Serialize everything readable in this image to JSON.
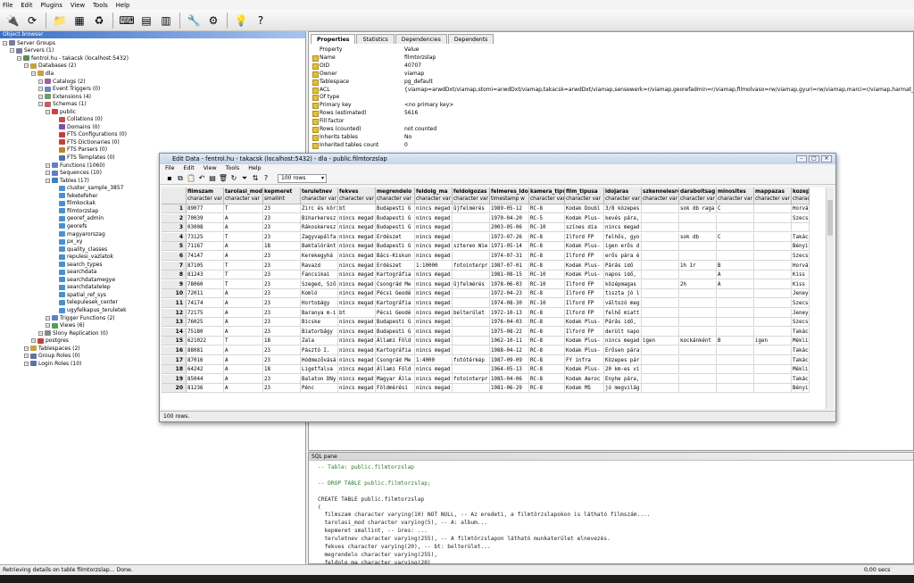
{
  "menubar": [
    "File",
    "Edit",
    "Plugins",
    "View",
    "Tools",
    "Help"
  ],
  "toolbar_icons": [
    "connect-icon",
    "refresh-icon",
    "folder-icon",
    "properties-icon",
    "recycle-icon",
    "sql-icon",
    "table-view-icon",
    "filter-icon",
    "wrench-icon",
    "plugin-icon",
    "help-bulb-icon",
    "help-icon"
  ],
  "browser": {
    "title": "Object browser",
    "tree": [
      {
        "label": "Server Groups",
        "level": 0,
        "icon": "#7a7aa0"
      },
      {
        "label": "Servers (1)",
        "level": 1,
        "icon": "#7a7aa0"
      },
      {
        "label": "fentrol.hu - takacsk (localhost:5432)",
        "level": 2,
        "icon": "#5a8a5a"
      },
      {
        "label": "Databases (2)",
        "level": 3,
        "icon": "#c8a040"
      },
      {
        "label": "dla",
        "level": 4,
        "icon": "#c8a040"
      },
      {
        "label": "Catalogs (2)",
        "level": 5,
        "icon": "#a060a0"
      },
      {
        "label": "Event Triggers (0)",
        "level": 5,
        "icon": "#6a8ac0"
      },
      {
        "label": "Extensions (4)",
        "level": 5,
        "icon": "#6aa06a"
      },
      {
        "label": "Schemas (1)",
        "level": 5,
        "icon": "#c06060"
      },
      {
        "label": "public",
        "level": 6,
        "icon": "#d04040"
      },
      {
        "label": "Collations (0)",
        "level": 7,
        "icon": "#c05050"
      },
      {
        "label": "Domains (0)",
        "level": 7,
        "icon": "#8050a0"
      },
      {
        "label": "FTS Configurations (0)",
        "level": 7,
        "icon": "#c04040"
      },
      {
        "label": "FTS Dictionaries (0)",
        "level": 7,
        "icon": "#c04040"
      },
      {
        "label": "FTS Parsers (0)",
        "level": 7,
        "icon": "#c08030"
      },
      {
        "label": "FTS Templates (0)",
        "level": 7,
        "icon": "#5070b0"
      },
      {
        "label": "Functions (1060)",
        "level": 6,
        "icon": "#6080c0"
      },
      {
        "label": "Sequences (10)",
        "level": 6,
        "icon": "#6080c0"
      },
      {
        "label": "Tables (17)",
        "level": 6,
        "icon": "#4080c0"
      },
      {
        "label": "cluster_sample_3857",
        "level": 7,
        "icon": "#4a90d0"
      },
      {
        "label": "feketefeher",
        "level": 7,
        "icon": "#4a90d0"
      },
      {
        "label": "filmkockak",
        "level": 7,
        "icon": "#4a90d0"
      },
      {
        "label": "filmtorzslap",
        "level": 7,
        "icon": "#4a90d0"
      },
      {
        "label": "georef_admin",
        "level": 7,
        "icon": "#4a90d0"
      },
      {
        "label": "georefs",
        "level": 7,
        "icon": "#4a90d0"
      },
      {
        "label": "magyarorszag",
        "level": 7,
        "icon": "#4a90d0"
      },
      {
        "label": "px_xy",
        "level": 7,
        "icon": "#4a90d0"
      },
      {
        "label": "quality_classes",
        "level": 7,
        "icon": "#4a90d0"
      },
      {
        "label": "repulesi_vazlatok",
        "level": 7,
        "icon": "#4a90d0"
      },
      {
        "label": "search_types",
        "level": 7,
        "icon": "#4a90d0"
      },
      {
        "label": "searchdata",
        "level": 7,
        "icon": "#4a90d0"
      },
      {
        "label": "searchdatamegye",
        "level": 7,
        "icon": "#4a90d0"
      },
      {
        "label": "searchdatatelep",
        "level": 7,
        "icon": "#4a90d0"
      },
      {
        "label": "spatial_ref_sys",
        "level": 7,
        "icon": "#4a90d0"
      },
      {
        "label": "telepulesek_center",
        "level": 7,
        "icon": "#4a90d0"
      },
      {
        "label": "ugyfelkapus_teruletek",
        "level": 7,
        "icon": "#4a90d0"
      },
      {
        "label": "Trigger Functions (2)",
        "level": 6,
        "icon": "#6080c0"
      },
      {
        "label": "Views (6)",
        "level": 6,
        "icon": "#50a050"
      },
      {
        "label": "Slony Replication (0)",
        "level": 5,
        "icon": "#8a8a8a"
      },
      {
        "label": "postgres",
        "level": 4,
        "icon": "#c04040"
      },
      {
        "label": "Tablespaces (2)",
        "level": 3,
        "icon": "#c8a040"
      },
      {
        "label": "Group Roles (0)",
        "level": 3,
        "icon": "#6070a0"
      },
      {
        "label": "Login Roles (10)",
        "level": 3,
        "icon": "#6070a0"
      }
    ]
  },
  "props": {
    "tabs": [
      "Properties",
      "Statistics",
      "Dependencies",
      "Dependents"
    ],
    "head": {
      "k": "Property",
      "v": "Value"
    },
    "rows": [
      {
        "k": "Name",
        "v": "filmtorzslap"
      },
      {
        "k": "OID",
        "v": "40707"
      },
      {
        "k": "Owner",
        "v": "viamap"
      },
      {
        "k": "Tablespace",
        "v": "pg_default"
      },
      {
        "k": "ACL",
        "v": "{viamap=arwdDxt/viamap,stomi=arwdDxt/viamap,takacsk=arwdDxt/viamap,sensewerk=r/viamap,georefadmin=r/viamap,filmolvaso=rw/viamap,gyuri=rw/viamap,marci=r/viamap,harmat_miklos=rw/viamap}"
      },
      {
        "k": "Of type",
        "v": ""
      },
      {
        "k": "Primary key",
        "v": "<no primary key>"
      },
      {
        "k": "Rows (estimated)",
        "v": "5616"
      },
      {
        "k": "Fill factor",
        "v": ""
      },
      {
        "k": "Rows (counted)",
        "v": "not counted"
      },
      {
        "k": "Inherits tables",
        "v": "No"
      },
      {
        "k": "Inherited tables count",
        "v": "0"
      }
    ]
  },
  "sql": {
    "title": "SQL pane",
    "lines": [
      {
        "t": "-- Table: public.filmtorzslap",
        "c": true
      },
      {
        "t": "",
        "c": false
      },
      {
        "t": "-- DROP TABLE public.filmtorzslap;",
        "c": true
      },
      {
        "t": "",
        "c": false
      },
      {
        "t": "CREATE TABLE public.filmtorzslap",
        "c": false
      },
      {
        "t": "(",
        "c": false
      },
      {
        "t": "  filmszam character varying(10) NOT NULL, -- Az eredeti, a filmtörzslapokon is látható filmszám....",
        "c": false
      },
      {
        "t": "  tarolasi_mod character varying(5), -- A: album...",
        "c": false
      },
      {
        "t": "  kepmeret smallint, -- üres: ...",
        "c": false
      },
      {
        "t": "  teruletnev character varying(255), -- A filmtörzslapon látható munkaterület elnevezés.",
        "c": false
      },
      {
        "t": "  fekves character varying(20), -- bt: belterület...",
        "c": false
      },
      {
        "t": "  megrendelo character varying(255),",
        "c": false
      },
      {
        "t": "  feldolg_ma character varying(20)",
        "c": false
      }
    ]
  },
  "status": {
    "left": "Retrieving details on table filmtorzslap... Done.",
    "right": "0,00 secs"
  },
  "edit": {
    "title": "Edit Data - fentrol.hu - takacsk (localhost:5432) - dla - public.filmtorzslap",
    "menu": [
      "File",
      "Edit",
      "View",
      "Tools",
      "Help"
    ],
    "rows_select": "100 rows",
    "status": "100 rows.",
    "columns": [
      {
        "n": "filmszam",
        "t": "character var"
      },
      {
        "n": "tarolasi_mod",
        "t": "character var"
      },
      {
        "n": "kepmeret",
        "t": "smallint"
      },
      {
        "n": "teruletnev",
        "t": "character var"
      },
      {
        "n": "fekves",
        "t": "character var"
      },
      {
        "n": "megrendelo",
        "t": "character var"
      },
      {
        "n": "feldolg_ma",
        "t": "character var"
      },
      {
        "n": "feldolgozas",
        "t": "character var"
      },
      {
        "n": "felmeres_ido",
        "t": "timestamp w"
      },
      {
        "n": "kamera_tipus",
        "t": "character var"
      },
      {
        "n": "film_tipusa",
        "t": "character var"
      },
      {
        "n": "idojaras",
        "t": "character var"
      },
      {
        "n": "szkennelesre",
        "t": "character var"
      },
      {
        "n": "daraboltsag",
        "t": "character var"
      },
      {
        "n": "minosites",
        "t": "character var"
      },
      {
        "n": "mappazas",
        "t": "character var"
      },
      {
        "n": "kozep",
        "t": "charac"
      }
    ],
    "rows": [
      [
        "89077",
        "T",
        "23",
        "Zirc és köri",
        "bt",
        "Budapesti G",
        "nincs megad",
        "ûjfelmérés",
        "1989-05-12",
        "RC-8",
        "Kodak Doubl",
        "3/8 közepes",
        "",
        "sok db raga",
        "C",
        "",
        "Horvá"
      ],
      [
        "70039",
        "A",
        "23",
        "Biharkeresz",
        "nincs megad",
        "Budapesti G",
        "nincs megad",
        "",
        "1970-04-20",
        "RC-5",
        "Kodak Plus-",
        "kevés pára,",
        "",
        "",
        "",
        "",
        "Szecs"
      ],
      [
        "03008",
        "A",
        "23",
        "Rákoskeresz",
        "nincs megad",
        "Budapesti G",
        "nincs megad",
        "",
        "2003-05-06",
        "RC-10",
        "színes dia",
        "nincs megad",
        "",
        "",
        "",
        "",
        ""
      ],
      [
        "73125",
        "T",
        "23",
        "Zagyvapálfa",
        "nincs megad",
        "Erdészet",
        "nincs megad",
        "",
        "1973-07-26",
        "RC-8",
        "Ilford FP",
        "felhős, gyo",
        "",
        "sok db",
        "C",
        "",
        "Takác"
      ],
      [
        "71167",
        "A",
        "18",
        "Baktalóránt",
        "nincs megad",
        "Budapesti G",
        "nincs megad",
        "sztereo Wie",
        "1971-05-14",
        "RC-8",
        "Kodak Plus-",
        "igen erős d",
        "",
        "",
        "",
        "",
        "Bényi"
      ],
      [
        "74147",
        "A",
        "23",
        "Kerekegyhá",
        "nincs megad",
        "Bács-Kiskun",
        "nincs megad",
        "",
        "1974-07-31",
        "RC-8",
        "Ilford FP",
        "erős pára é",
        "",
        "",
        "",
        "",
        "Szecs"
      ],
      [
        "87105",
        "T",
        "23",
        "Ravazd",
        "nincs megad",
        "Erdészet",
        "1:10000",
        "fotointerpr",
        "1987-07-01",
        "RC-8",
        "Kodak Plus-",
        "Párás idő",
        "",
        "1h 1r",
        "B",
        "",
        "Horvá"
      ],
      [
        "81243",
        "T",
        "23",
        "Fancsikai",
        "nincs megad",
        "Kartográfia",
        "nincs megad",
        "",
        "1981-08-15",
        "RC-10",
        "Kodak Plus-",
        "napos idő,",
        "",
        "",
        "A",
        "",
        "Kiss"
      ],
      [
        "78060",
        "T",
        "23",
        "Szeged, Sző",
        "nincs megad",
        "Csongrád Me",
        "nincs megad",
        "ûjfelmérés",
        "1978-06-03",
        "RC-10",
        "Ilford FP",
        "középmagas",
        "",
        "2h",
        "A",
        "",
        "Kiss"
      ],
      [
        "72011",
        "A",
        "23",
        "Komló",
        "nincs megad",
        "Pécsi Geodé",
        "nincs megad",
        "",
        "1972-04-23",
        "RC-8",
        "Ilford FP",
        "tiszta jó l",
        "",
        "",
        "",
        "",
        "Jeney"
      ],
      [
        "74174",
        "A",
        "23",
        "Hortobágy",
        "nincs megad",
        "Kartográfia",
        "nincs megad",
        "",
        "1974-08-30",
        "RC-10",
        "Ilford FP",
        "változó meg",
        "",
        "",
        "",
        "",
        "Szecs"
      ],
      [
        "72175",
        "A",
        "23",
        "Baranya m-i",
        "bt",
        "Pécsi Geodé",
        "nincs megad",
        "belterület",
        "1972-10-13",
        "RC-8",
        "Ilford FP",
        "felhő miatt",
        "",
        "",
        "",
        "",
        "Jeney"
      ],
      [
        "76025",
        "A",
        "23",
        "Bicske",
        "nincs megad",
        "Budapesti G",
        "nincs megad",
        "",
        "1976-04-03",
        "RC-8",
        "Kodak Plus-",
        "Párás idő,",
        "",
        "",
        "",
        "",
        "Szecs"
      ],
      [
        "75180",
        "A",
        "23",
        "Biatorbágy",
        "nincs megad",
        "Budapesti G",
        "nincs megad",
        "",
        "1975-08-22",
        "RC-8",
        "Ilford FP",
        "derült napo",
        "",
        "",
        "",
        "",
        "Takác"
      ],
      [
        "621022",
        "T",
        "18",
        "Zala",
        "nincs megad",
        "Állami Föld",
        "nincs megad",
        "",
        "1962-10-11",
        "RC-8",
        "Kodak Plus-",
        "nincs megad",
        "igen",
        "kockánként",
        "B",
        "igen",
        "Mékli"
      ],
      [
        "88081",
        "A",
        "23",
        "Pásztó I.",
        "nincs megad",
        "Kartográfia",
        "nincs megad",
        "",
        "1988-04-12",
        "RC-8",
        "Kodak Plus-",
        "Erősen pára",
        "",
        "",
        "",
        "",
        "Takác"
      ],
      [
        "87016",
        "A",
        "23",
        "Hódmezővásá",
        "nincs megad",
        "Csongrád Me",
        "1:4000",
        "fotótérkép",
        "1987-09-09",
        "RC-8",
        "FY infra",
        "Közepes pár",
        "",
        "",
        "",
        "",
        "Takác"
      ],
      [
        "64242",
        "A",
        "18",
        "Ligetfalva",
        "nincs megad",
        "Állami Föld",
        "nincs megad",
        "",
        "1964-05-13",
        "RC-8",
        "Kodak Plus-",
        "20 km-es vi",
        "",
        "",
        "",
        "",
        "Mékli"
      ],
      [
        "85044",
        "A",
        "23",
        "Balaton DNy",
        "nincs megad",
        "Magyar Álla",
        "nincs megad",
        "fotointerpr",
        "1985-04-06",
        "RC-8",
        "Kodak Aeroc",
        "Enyhe pára,",
        "",
        "",
        "",
        "",
        "Takác"
      ],
      [
        "81236",
        "A",
        "23",
        "Pénc",
        "nincs megad",
        "Földmérési",
        "nincs megad",
        "",
        "1981-06-29",
        "RC-8",
        "Kodak MS",
        "jó megvilág",
        "",
        "",
        "",
        "",
        "Bényi"
      ]
    ]
  }
}
